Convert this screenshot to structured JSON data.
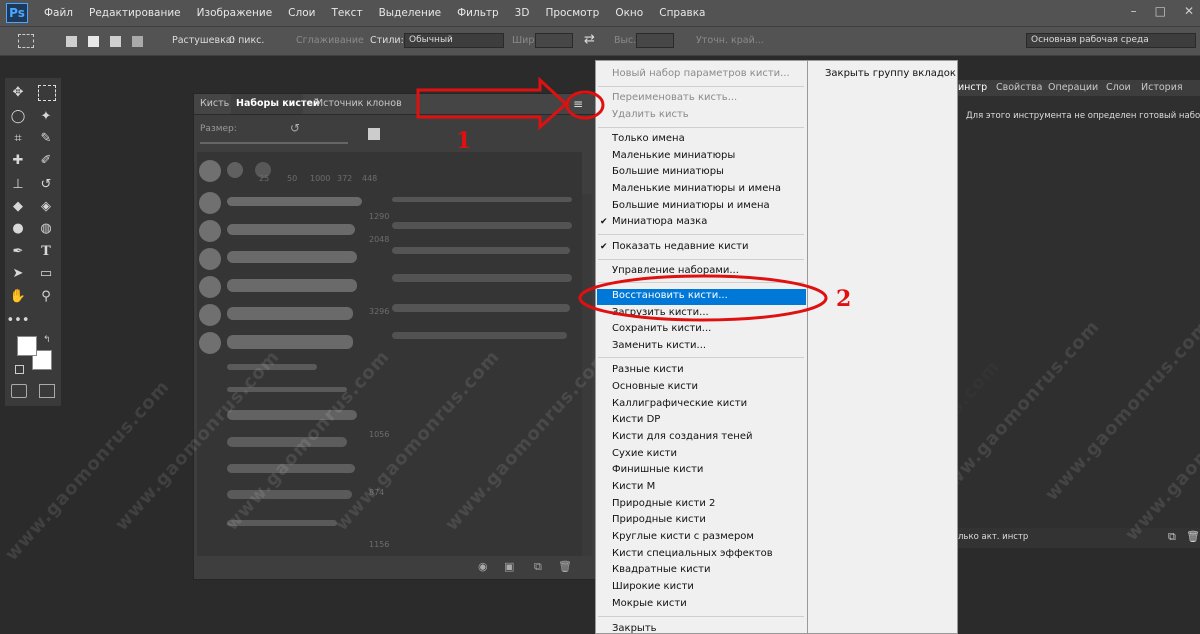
{
  "app": {
    "logo": "Ps"
  },
  "menubar": [
    "Файл",
    "Редактирование",
    "Изображение",
    "Слои",
    "Текст",
    "Выделение",
    "Фильтр",
    "3D",
    "Просмотр",
    "Окно",
    "Справка"
  ],
  "window_controls": [
    "–",
    "□",
    "✕"
  ],
  "options": {
    "feather_label": "Растушевка:",
    "feather_value": "0 пикс.",
    "antialias": "Сглаживание",
    "style_label": "Стили:",
    "style_value": "Обычный",
    "width_label": "Шир.:",
    "height_label": "Выс.:",
    "refine": "Уточн. край...",
    "workspace": "Основная рабочая среда"
  },
  "brush_panel": {
    "tabs": [
      "Кисть",
      "Наборы кистей",
      "Источник клонов"
    ],
    "size_label": "Размер:",
    "brush_numbers": [
      "25",
      "50",
      "1000",
      "372",
      "448",
      "1290",
      "2048",
      "3296",
      "1056",
      "874",
      "1156"
    ]
  },
  "right_panel": {
    "tabs": [
      "инстр",
      "Свойства",
      "Операции",
      "Слои",
      "История"
    ],
    "message": "Для этого инструмента не определен готовый набор.",
    "bottom_text": "лько акт. инстр"
  },
  "context_menu": {
    "items": [
      {
        "label": "Новый набор параметров кисти...",
        "disabled": true
      },
      {
        "label": "Переименовать кисть...",
        "disabled": true
      },
      {
        "label": "Удалить кисть",
        "disabled": true
      },
      {
        "label": "Только имена"
      },
      {
        "label": "Маленькие миниатюры"
      },
      {
        "label": "Большие миниатюры"
      },
      {
        "label": "Маленькие миниатюры и имена"
      },
      {
        "label": "Большие миниатюры и имена"
      },
      {
        "label": "Миниатюра мазка",
        "checked": true
      },
      {
        "label": "Показать недавние кисти",
        "checked": true
      },
      {
        "label": "Управление наборами..."
      },
      {
        "label": "Восстановить кисти...",
        "highlighted": true
      },
      {
        "label": "Загрузить кисти..."
      },
      {
        "label": "Сохранить кисти..."
      },
      {
        "label": "Заменить кисти..."
      },
      {
        "label": "Разные кисти"
      },
      {
        "label": "Основные кисти"
      },
      {
        "label": "Каллиграфические кисти"
      },
      {
        "label": "Кисти DP"
      },
      {
        "label": "Кисти для создания теней"
      },
      {
        "label": "Сухие кисти"
      },
      {
        "label": "Финишные кисти"
      },
      {
        "label": "Кисти M"
      },
      {
        "label": "Природные кисти 2"
      },
      {
        "label": "Природные кисти"
      },
      {
        "label": "Круглые кисти с размером"
      },
      {
        "label": "Кисти специальных эффектов"
      },
      {
        "label": "Квадратные кисти"
      },
      {
        "label": "Широкие кисти"
      },
      {
        "label": "Мокрые кисти"
      },
      {
        "label": "Закрыть"
      }
    ],
    "close_group": "Закрыть группу вкладок"
  },
  "annotations": [
    "1",
    "2"
  ],
  "watermark": "www.gaomonrus.com",
  "colors": {
    "accent_red": "#e01010",
    "highlight": "#0078d7"
  }
}
